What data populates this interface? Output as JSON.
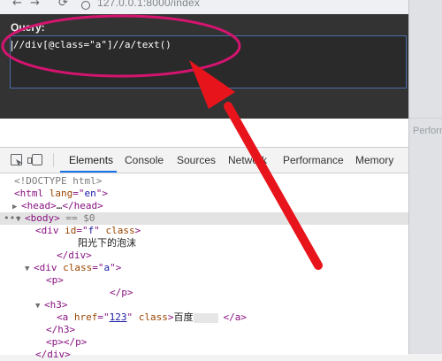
{
  "browser": {
    "url": "127.0.0.1:8000/index"
  },
  "xpath_helper": {
    "query_label": "Query:",
    "query_value": "//div[@class=\"a\"]//a/text()"
  },
  "right_peek": {
    "tab_stub": "Perform"
  },
  "devtools": {
    "tabs": [
      "Elements",
      "Console",
      "Sources",
      "Network",
      "Performance",
      "Memory"
    ],
    "active_tab": "Elements",
    "tree": {
      "doctype": "<!DOCTYPE html>",
      "html_lang": "en",
      "head_collapsed": "…",
      "body_marker": "== $0",
      "div_f_class": "f",
      "div_f_text": "阳光下的泡沫",
      "div_a_class": "a",
      "href": "123",
      "a_text": "百度"
    }
  },
  "annotation": {
    "ellipse_color": "#d4146f",
    "arrow_color": "#e8141c"
  }
}
